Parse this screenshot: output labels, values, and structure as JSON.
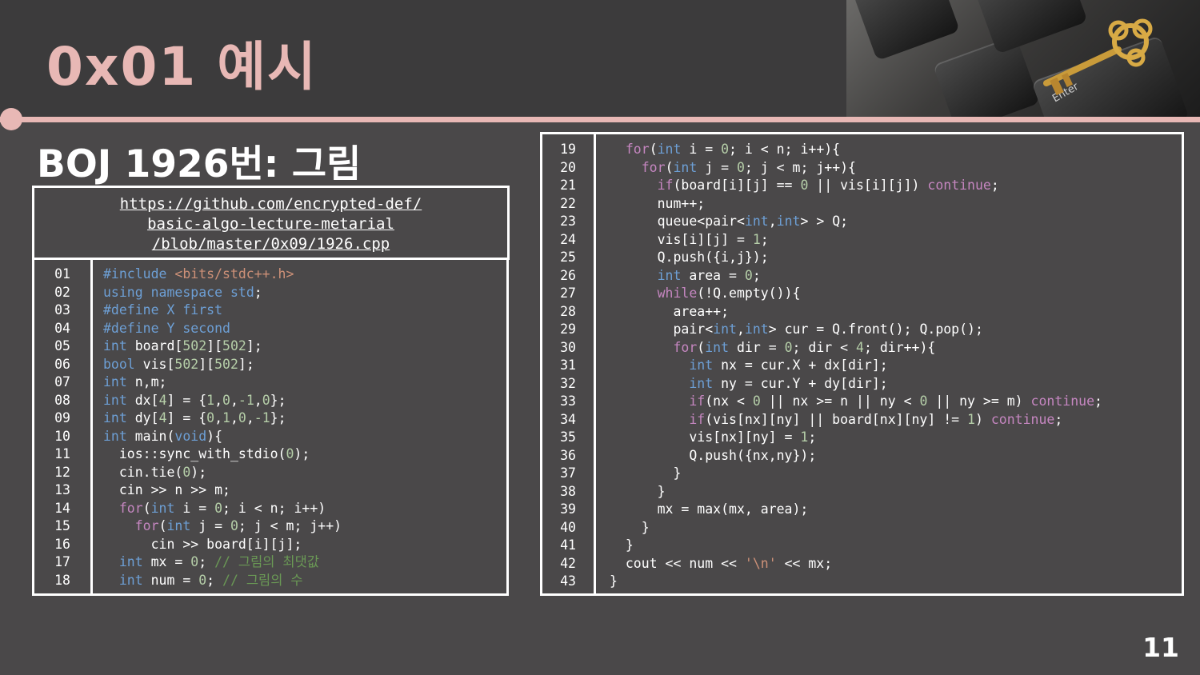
{
  "slide": {
    "title": "0x01 예시",
    "subtitle": "BOJ 1926번: 그림",
    "page_number": "11"
  },
  "link": {
    "line1": "https://github.com/encrypted-def/",
    "line2": "basic-algo-lecture-metarial",
    "line3": "/blob/master/0x09/1926.cpp"
  },
  "hero": {
    "keys": [
      "Enter"
    ]
  },
  "colors": {
    "title_pink": "#e8b8b5",
    "background": "#4a4849",
    "keyword_blue": "#6d9fd5",
    "keyword_purple": "#c586c0",
    "number_green": "#b5cea8",
    "string_orange": "#ce9178",
    "comment_green": "#6a9955"
  },
  "code_left": [
    {
      "n": "01",
      "tokens": [
        [
          "pp",
          "#include "
        ],
        [
          "inc",
          "<bits/stdc++.h>"
        ]
      ]
    },
    {
      "n": "02",
      "tokens": [
        [
          "kw",
          "using"
        ],
        [
          "t",
          " "
        ],
        [
          "kw",
          "namespace"
        ],
        [
          "t",
          " "
        ],
        [
          "kw",
          "std"
        ],
        [
          "t",
          ";"
        ]
      ]
    },
    {
      "n": "03",
      "tokens": [
        [
          "pp",
          "#define X first"
        ]
      ]
    },
    {
      "n": "04",
      "tokens": [
        [
          "pp",
          "#define Y second"
        ]
      ]
    },
    {
      "n": "05",
      "tokens": [
        [
          "kw",
          "int"
        ],
        [
          "t",
          " board["
        ],
        [
          "num",
          "502"
        ],
        [
          "t",
          "]["
        ],
        [
          "num",
          "502"
        ],
        [
          "t",
          "];"
        ]
      ]
    },
    {
      "n": "06",
      "tokens": [
        [
          "kw",
          "bool"
        ],
        [
          "t",
          " vis["
        ],
        [
          "num",
          "502"
        ],
        [
          "t",
          "]["
        ],
        [
          "num",
          "502"
        ],
        [
          "t",
          "];"
        ]
      ]
    },
    {
      "n": "07",
      "tokens": [
        [
          "kw",
          "int"
        ],
        [
          "t",
          " n,m;"
        ]
      ]
    },
    {
      "n": "08",
      "tokens": [
        [
          "kw",
          "int"
        ],
        [
          "t",
          " dx["
        ],
        [
          "num",
          "4"
        ],
        [
          "t",
          "] = {"
        ],
        [
          "num",
          "1"
        ],
        [
          "t",
          ","
        ],
        [
          "num",
          "0"
        ],
        [
          "t",
          ","
        ],
        [
          "num",
          "-1"
        ],
        [
          "t",
          ","
        ],
        [
          "num",
          "0"
        ],
        [
          "t",
          "};"
        ]
      ]
    },
    {
      "n": "09",
      "tokens": [
        [
          "kw",
          "int"
        ],
        [
          "t",
          " dy["
        ],
        [
          "num",
          "4"
        ],
        [
          "t",
          "] = {"
        ],
        [
          "num",
          "0"
        ],
        [
          "t",
          ","
        ],
        [
          "num",
          "1"
        ],
        [
          "t",
          ","
        ],
        [
          "num",
          "0"
        ],
        [
          "t",
          ","
        ],
        [
          "num",
          "-1"
        ],
        [
          "t",
          "};"
        ]
      ]
    },
    {
      "n": "10",
      "tokens": [
        [
          "kw",
          "int"
        ],
        [
          "t",
          " main("
        ],
        [
          "kw",
          "void"
        ],
        [
          "t",
          "){"
        ]
      ]
    },
    {
      "n": "11",
      "tokens": [
        [
          "t",
          "  ios::sync_with_stdio("
        ],
        [
          "num",
          "0"
        ],
        [
          "t",
          ");"
        ]
      ]
    },
    {
      "n": "12",
      "tokens": [
        [
          "t",
          "  cin.tie("
        ],
        [
          "num",
          "0"
        ],
        [
          "t",
          ");"
        ]
      ]
    },
    {
      "n": "13",
      "tokens": [
        [
          "t",
          "  cin >> n >> m;"
        ]
      ]
    },
    {
      "n": "14",
      "tokens": [
        [
          "t",
          "  "
        ],
        [
          "kw2",
          "for"
        ],
        [
          "t",
          "("
        ],
        [
          "kw",
          "int"
        ],
        [
          "t",
          " i = "
        ],
        [
          "num",
          "0"
        ],
        [
          "t",
          "; i < n; i++)"
        ]
      ]
    },
    {
      "n": "15",
      "tokens": [
        [
          "t",
          "    "
        ],
        [
          "kw2",
          "for"
        ],
        [
          "t",
          "("
        ],
        [
          "kw",
          "int"
        ],
        [
          "t",
          " j = "
        ],
        [
          "num",
          "0"
        ],
        [
          "t",
          "; j < m; j++)"
        ]
      ]
    },
    {
      "n": "16",
      "tokens": [
        [
          "t",
          "      cin >> board[i][j];"
        ]
      ]
    },
    {
      "n": "17",
      "tokens": [
        [
          "t",
          "  "
        ],
        [
          "kw",
          "int"
        ],
        [
          "t",
          " mx = "
        ],
        [
          "num",
          "0"
        ],
        [
          "t",
          "; "
        ],
        [
          "cm",
          "// 그림의 최댓값"
        ]
      ]
    },
    {
      "n": "18",
      "tokens": [
        [
          "t",
          "  "
        ],
        [
          "kw",
          "int"
        ],
        [
          "t",
          " num = "
        ],
        [
          "num",
          "0"
        ],
        [
          "t",
          "; "
        ],
        [
          "cm",
          "// 그림의 수"
        ]
      ]
    }
  ],
  "code_right": [
    {
      "n": "19",
      "tokens": [
        [
          "t",
          "  "
        ],
        [
          "kw2",
          "for"
        ],
        [
          "t",
          "("
        ],
        [
          "kw",
          "int"
        ],
        [
          "t",
          " i = "
        ],
        [
          "num",
          "0"
        ],
        [
          "t",
          "; i < n; i++){"
        ]
      ]
    },
    {
      "n": "20",
      "tokens": [
        [
          "t",
          "    "
        ],
        [
          "kw2",
          "for"
        ],
        [
          "t",
          "("
        ],
        [
          "kw",
          "int"
        ],
        [
          "t",
          " j = "
        ],
        [
          "num",
          "0"
        ],
        [
          "t",
          "; j < m; j++){"
        ]
      ]
    },
    {
      "n": "21",
      "tokens": [
        [
          "t",
          "      "
        ],
        [
          "kw2",
          "if"
        ],
        [
          "t",
          "(board[i][j] == "
        ],
        [
          "num",
          "0"
        ],
        [
          "t",
          " || vis[i][j]) "
        ],
        [
          "kw2",
          "continue"
        ],
        [
          "t",
          ";"
        ]
      ]
    },
    {
      "n": "22",
      "tokens": [
        [
          "t",
          "      num++;"
        ]
      ]
    },
    {
      "n": "23",
      "tokens": [
        [
          "t",
          "      queue<pair<"
        ],
        [
          "kw",
          "int"
        ],
        [
          "t",
          ","
        ],
        [
          "kw",
          "int"
        ],
        [
          "t",
          "> > Q;"
        ]
      ]
    },
    {
      "n": "24",
      "tokens": [
        [
          "t",
          "      vis[i][j] = "
        ],
        [
          "num",
          "1"
        ],
        [
          "t",
          ";"
        ]
      ]
    },
    {
      "n": "25",
      "tokens": [
        [
          "t",
          "      Q.push({i,j});"
        ]
      ]
    },
    {
      "n": "26",
      "tokens": [
        [
          "t",
          "      "
        ],
        [
          "kw",
          "int"
        ],
        [
          "t",
          " area = "
        ],
        [
          "num",
          "0"
        ],
        [
          "t",
          ";"
        ]
      ]
    },
    {
      "n": "27",
      "tokens": [
        [
          "t",
          "      "
        ],
        [
          "kw2",
          "while"
        ],
        [
          "t",
          "(!Q.empty()){"
        ]
      ]
    },
    {
      "n": "28",
      "tokens": [
        [
          "t",
          "        area++;"
        ]
      ]
    },
    {
      "n": "29",
      "tokens": [
        [
          "t",
          "        pair<"
        ],
        [
          "kw",
          "int"
        ],
        [
          "t",
          ","
        ],
        [
          "kw",
          "int"
        ],
        [
          "t",
          "> cur = Q.front(); Q.pop();"
        ]
      ]
    },
    {
      "n": "30",
      "tokens": [
        [
          "t",
          "        "
        ],
        [
          "kw2",
          "for"
        ],
        [
          "t",
          "("
        ],
        [
          "kw",
          "int"
        ],
        [
          "t",
          " dir = "
        ],
        [
          "num",
          "0"
        ],
        [
          "t",
          "; dir < "
        ],
        [
          "num",
          "4"
        ],
        [
          "t",
          "; dir++){"
        ]
      ]
    },
    {
      "n": "31",
      "tokens": [
        [
          "t",
          "          "
        ],
        [
          "kw",
          "int"
        ],
        [
          "t",
          " nx = cur.X + dx[dir];"
        ]
      ]
    },
    {
      "n": "32",
      "tokens": [
        [
          "t",
          "          "
        ],
        [
          "kw",
          "int"
        ],
        [
          "t",
          " ny = cur.Y + dy[dir];"
        ]
      ]
    },
    {
      "n": "33",
      "tokens": [
        [
          "t",
          "          "
        ],
        [
          "kw2",
          "if"
        ],
        [
          "t",
          "(nx < "
        ],
        [
          "num",
          "0"
        ],
        [
          "t",
          " || nx >= n || ny < "
        ],
        [
          "num",
          "0"
        ],
        [
          "t",
          " || ny >= m) "
        ],
        [
          "kw2",
          "continue"
        ],
        [
          "t",
          ";"
        ]
      ]
    },
    {
      "n": "34",
      "tokens": [
        [
          "t",
          "          "
        ],
        [
          "kw2",
          "if"
        ],
        [
          "t",
          "(vis[nx][ny] || board[nx][ny] != "
        ],
        [
          "num",
          "1"
        ],
        [
          "t",
          ") "
        ],
        [
          "kw2",
          "continue"
        ],
        [
          "t",
          ";"
        ]
      ]
    },
    {
      "n": "35",
      "tokens": [
        [
          "t",
          "          vis[nx][ny] = "
        ],
        [
          "num",
          "1"
        ],
        [
          "t",
          ";"
        ]
      ]
    },
    {
      "n": "36",
      "tokens": [
        [
          "t",
          "          Q.push({nx,ny});"
        ]
      ]
    },
    {
      "n": "37",
      "tokens": [
        [
          "t",
          "        }"
        ]
      ]
    },
    {
      "n": "38",
      "tokens": [
        [
          "t",
          "      }"
        ]
      ]
    },
    {
      "n": "39",
      "tokens": [
        [
          "t",
          "      mx = max(mx, area);"
        ]
      ]
    },
    {
      "n": "40",
      "tokens": [
        [
          "t",
          "    }"
        ]
      ]
    },
    {
      "n": "41",
      "tokens": [
        [
          "t",
          "  }"
        ]
      ]
    },
    {
      "n": "42",
      "tokens": [
        [
          "t",
          "  cout << num << "
        ],
        [
          "str",
          "'\\n'"
        ],
        [
          "t",
          " << mx;"
        ]
      ]
    },
    {
      "n": "43",
      "tokens": [
        [
          "t",
          "}"
        ]
      ]
    }
  ]
}
